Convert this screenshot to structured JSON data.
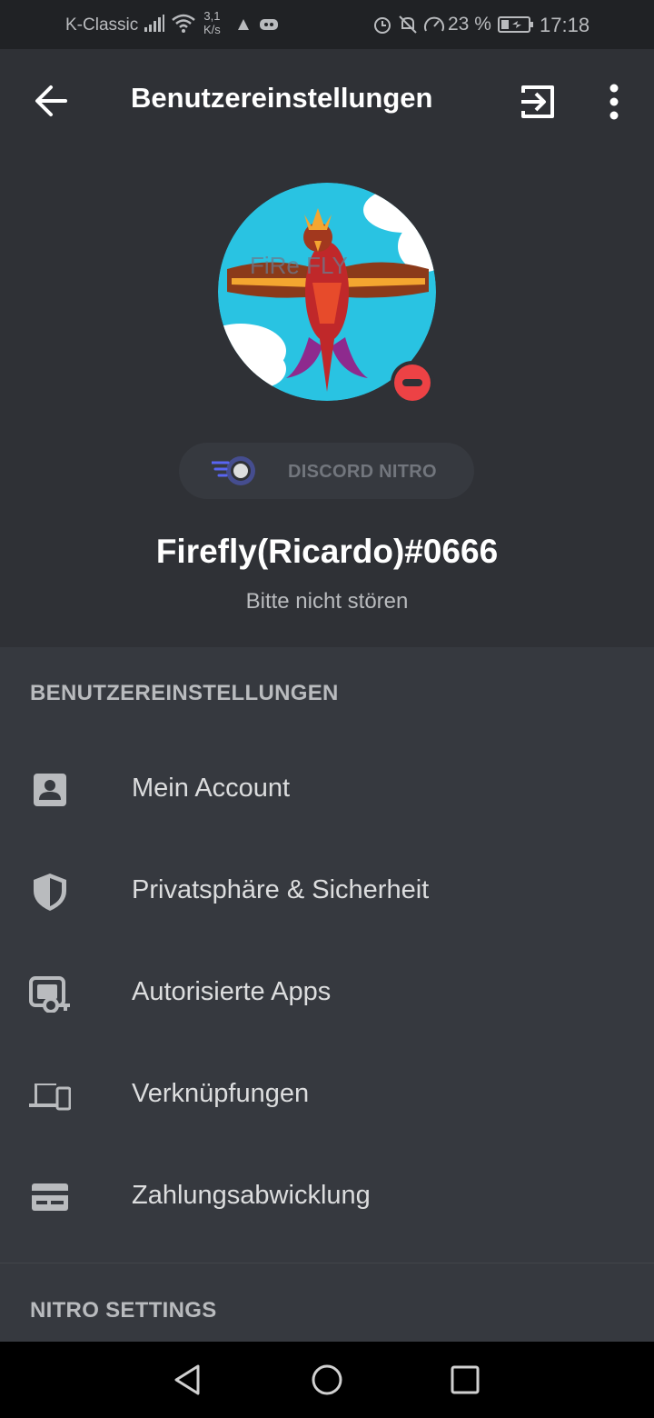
{
  "status_bar": {
    "carrier": "K-Classic",
    "netspeed_value": "3,1",
    "netspeed_unit": "K/s",
    "battery_pct": "23 %",
    "clock": "17:18"
  },
  "header": {
    "title": "Benutzereinstellungen"
  },
  "profile": {
    "nitro_label": "DISCORD NITRO",
    "username": "Firefly(Ricardo)#0666",
    "status": "Bitte nicht stören",
    "avatar_text": "FiRe FLY",
    "status_color": "#ed4245"
  },
  "settings": {
    "section_title": "BENUTZEREINSTELLUNGEN",
    "items": [
      {
        "label": "Mein Account",
        "icon": "account-card-icon"
      },
      {
        "label": "Privatsphäre & Sicherheit",
        "icon": "shield-icon"
      },
      {
        "label": "Autorisierte Apps",
        "icon": "authorized-apps-icon"
      },
      {
        "label": "Verknüpfungen",
        "icon": "devices-icon"
      },
      {
        "label": "Zahlungsabwicklung",
        "icon": "credit-card-icon"
      }
    ]
  },
  "nitro_settings": {
    "section_title": "NITRO SETTINGS"
  },
  "colors": {
    "background": "#36393f",
    "header_bg": "#2f3136",
    "accent": "#5865f2"
  }
}
